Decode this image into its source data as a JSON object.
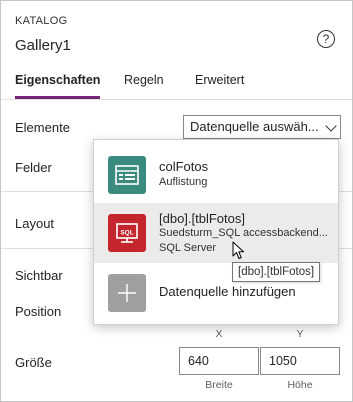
{
  "panel": {
    "type_label": "KATALOG",
    "title": "Gallery1",
    "help_icon": "?"
  },
  "tabs": [
    {
      "label": "Eigenschaften",
      "active": true
    },
    {
      "label": "Regeln",
      "active": false
    },
    {
      "label": "Erweitert",
      "active": false
    }
  ],
  "properties": {
    "elemente_label": "Elemente",
    "elemente_value": "Datenquelle auswäh...",
    "felder_label": "Felder",
    "layout_label": "Layout",
    "sichtbar_label": "Sichtbar",
    "position_label": "Position",
    "x_label": "X",
    "y_label": "Y",
    "groesse_label": "Größe",
    "breite_value": "640",
    "hoehe_value": "1050",
    "breite_label": "Breite",
    "hoehe_label": "Höhe"
  },
  "datasource_popup": {
    "options": [
      {
        "title": "colFotos",
        "subtitle": "Auflistung",
        "icon": "collection-icon",
        "icon_color": "#3a8a7e"
      },
      {
        "title": "[dbo].[tblFotos]",
        "subtitle": "Suedsturm_SQL accessbackend...",
        "subtitle2": "SQL Server",
        "icon": "sql-server-icon",
        "icon_color": "#c4262e"
      },
      {
        "title": "Datenquelle hinzufügen",
        "icon": "plus-icon",
        "icon_color": "#a19f9d"
      }
    ],
    "tooltip": "[dbo].[tblFotos]"
  },
  "colors": {
    "accent": "#742774",
    "hover": "#edebe9"
  }
}
